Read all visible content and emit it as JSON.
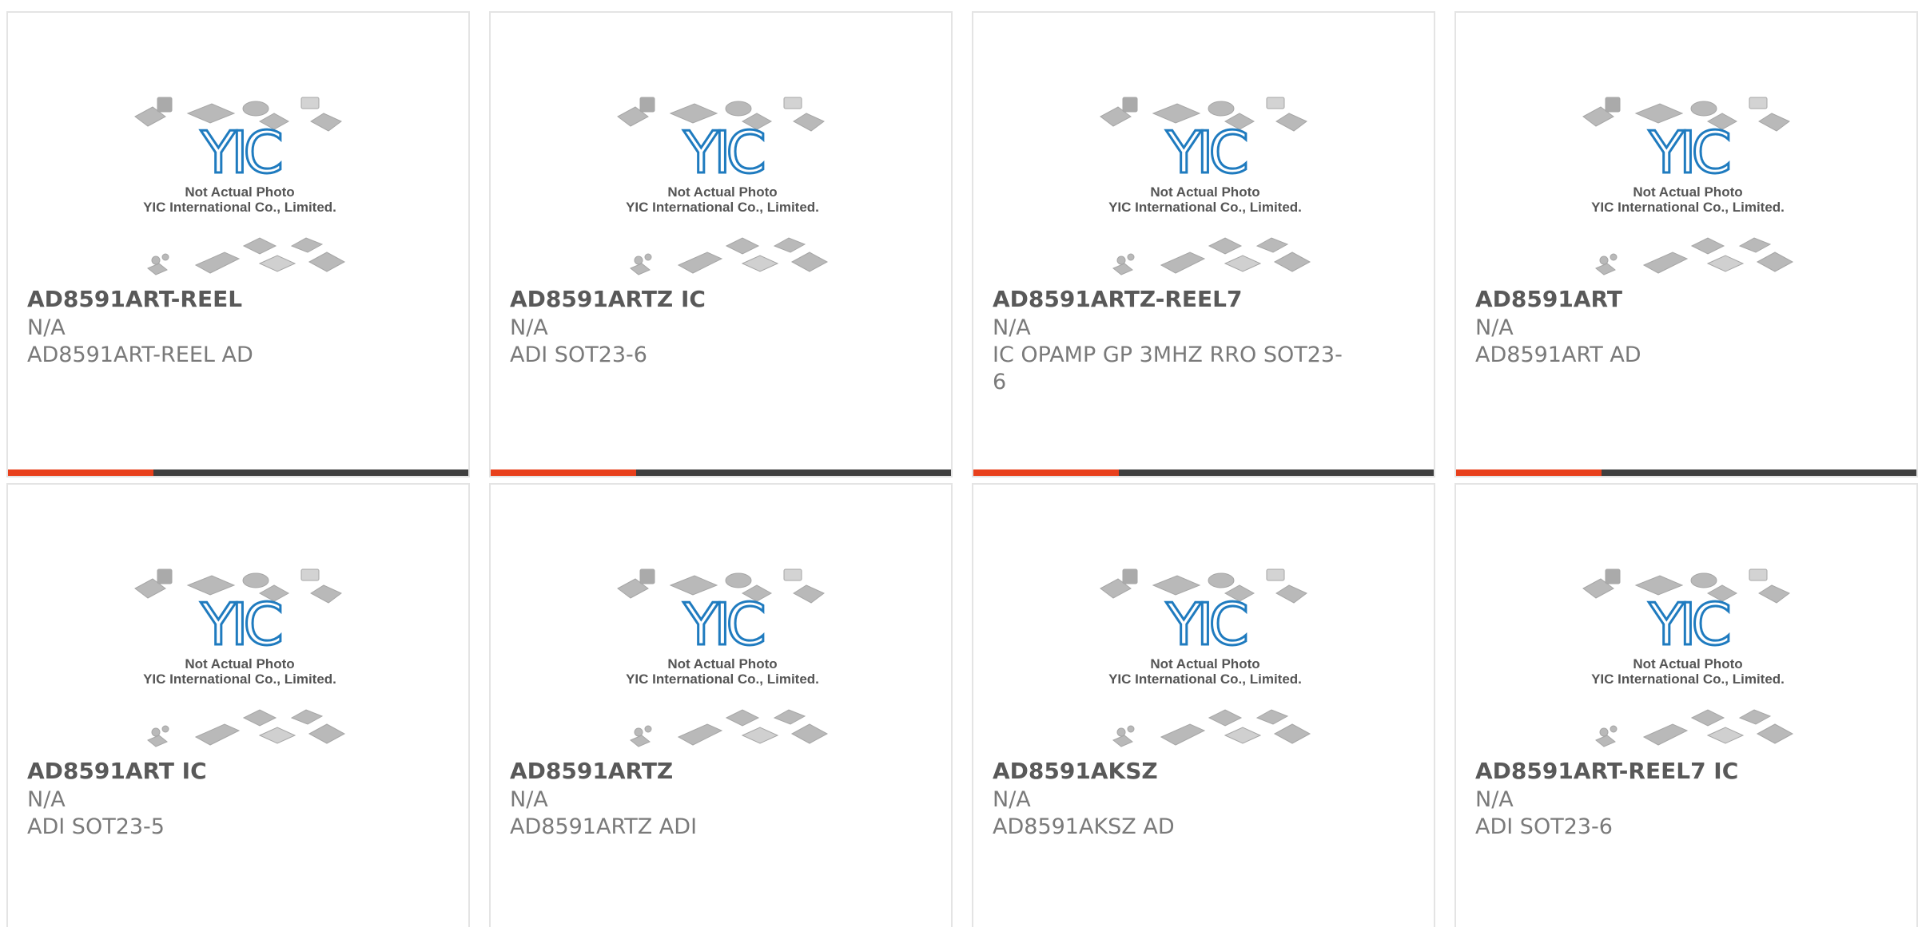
{
  "colors": {
    "accent": "#e8401c",
    "bar": "#3f3f3f",
    "logo": "#1f7bbf",
    "name_text": "#595959",
    "sub_text": "#7a7a7a"
  },
  "placeholder": {
    "logo_text": "YIC",
    "line1": "Not Actual Photo",
    "line2": "YIC International Co., Limited."
  },
  "products": [
    {
      "name": "AD8591ART-REEL",
      "availability": "N/A",
      "description": "AD8591ART-REEL AD"
    },
    {
      "name": "AD8591ARTZ IC",
      "availability": "N/A",
      "description": "ADI SOT23-6"
    },
    {
      "name": "AD8591ARTZ-REEL7",
      "availability": "N/A",
      "description": "IC OPAMP GP 3MHZ RRO SOT23-6"
    },
    {
      "name": "AD8591ART",
      "availability": "N/A",
      "description": "AD8591ART AD"
    },
    {
      "name": "AD8591ART IC",
      "availability": "N/A",
      "description": "ADI SOT23-5"
    },
    {
      "name": "AD8591ARTZ",
      "availability": "N/A",
      "description": "AD8591ARTZ ADI"
    },
    {
      "name": "AD8591AKSZ",
      "availability": "N/A",
      "description": "AD8591AKSZ AD"
    },
    {
      "name": "AD8591ART-REEL7 IC",
      "availability": "N/A",
      "description": "ADI SOT23-6"
    }
  ]
}
